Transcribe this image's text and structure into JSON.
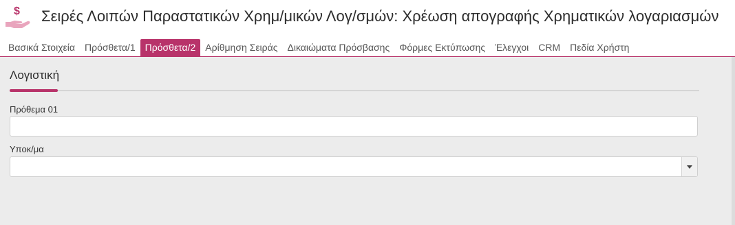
{
  "header": {
    "icon": "money-hand-icon",
    "title": "Σειρές Λοιπών Παραστατικών Χρημ/μικών Λογ/σμών: Χρέωση απογραφής Χρηματικών λογαριασμών",
    "accent_color": "#b8336a"
  },
  "tabs": [
    {
      "label": "Βασικά Στοιχεία",
      "active": false
    },
    {
      "label": "Πρόσθετα/1",
      "active": false
    },
    {
      "label": "Πρόσθετα/2",
      "active": true
    },
    {
      "label": "Αρίθμηση Σειράς",
      "active": false
    },
    {
      "label": "Δικαιώματα Πρόσβασης",
      "active": false
    },
    {
      "label": "Φόρμες Εκτύπωσης",
      "active": false
    },
    {
      "label": "Έλεγχοι",
      "active": false
    },
    {
      "label": "CRM",
      "active": false
    },
    {
      "label": "Πεδία Χρήστη",
      "active": false
    }
  ],
  "section": {
    "title": "Λογιστική"
  },
  "fields": {
    "prefix": {
      "label": "Πρόθεμα 01",
      "value": ""
    },
    "branch": {
      "label": "Υποκ/μα",
      "value": ""
    }
  }
}
